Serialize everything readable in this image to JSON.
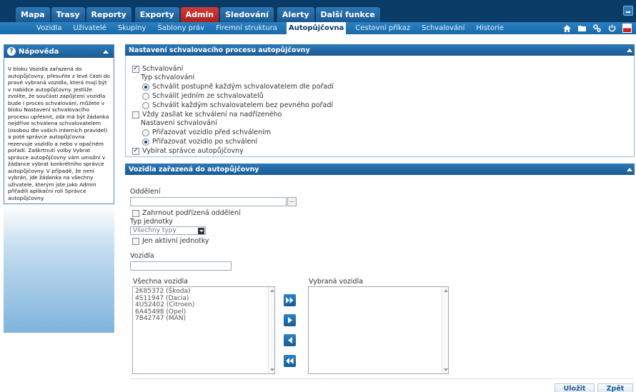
{
  "nav": {
    "tabs": [
      {
        "label": "Mapa"
      },
      {
        "label": "Trasy"
      },
      {
        "label": "Reporty"
      },
      {
        "label": "Exporty"
      },
      {
        "label": "Admin"
      },
      {
        "label": "Sledování"
      },
      {
        "label": "Alerty"
      },
      {
        "label": "Další funkce"
      }
    ],
    "active_tab": "Admin",
    "subnav": [
      {
        "label": "Vozidla"
      },
      {
        "label": "Uživatelé"
      },
      {
        "label": "Skupiny"
      },
      {
        "label": "Šablony práv"
      },
      {
        "label": "Firemní struktura"
      },
      {
        "label": "Autopůjčovna"
      },
      {
        "label": "Cestovní příkaz"
      },
      {
        "label": "Schvalování"
      },
      {
        "label": "Historie"
      }
    ],
    "active_subnav": "Autopůjčovna",
    "tools": {
      "home_icon": "home-icon",
      "folder_icon": "folder-icon",
      "settings_icon": "settings-icon",
      "power_icon": "power-icon",
      "flag_icon": "flag-cz-icon"
    }
  },
  "help": {
    "title": "Nápověda",
    "text": "V bloku Vozidla zařazená do autopůjčovny, přesuňte z levé části do pravé vybraná vozidla, která mají být v nabídce autopůjčovny. Jestliže zvolíte, že součástí zapůjčení vozidla bude i proces schvalování, můžete v bloku Nastavení schvalovacího procesu upřesnit, zda má být žádanka nejdříve schválena schvalovatelem (osobou dle vašich interních pravidel) a poté správce autopůjčovna rezervuje vozidlo a nebo v opačném pořadí. Zaškrtnutí volby Vybrat správce autopůjčovny vám umožní v žádance vybrat konkrétního správce autopůjčovny. V případě, že není vybrán, jde žádanka na všechny uživatele, kterým jste jako Admin přiřadili aplikační roli Správce autopůjčovny."
  },
  "approval": {
    "panel_title": "Nastavení schvalovacího procesu autopůjčovny",
    "schvalovani_label": "Schvalování",
    "schvalovani_checked": true,
    "type_label": "Typ schvalování",
    "type_options": [
      {
        "label": "Schválit postupně každým schvalovatelem dle pořadí",
        "selected": true
      },
      {
        "label": "Schválit jedním ze schvalovatelů",
        "selected": false
      },
      {
        "label": "Schválit každým schvalovatelem bez pevného pořadí",
        "selected": false
      }
    ],
    "superior_label": "Vždy zasílat ke schválení na nadřízeného",
    "superior_checked": false,
    "settings_label": "Nastavení schvalování",
    "settings_options": [
      {
        "label": "Přiřazovat vozidlo před schválením",
        "selected": false
      },
      {
        "label": "Přiřazovat vozidlo po schválení",
        "selected": true
      }
    ],
    "manager_label": "Vybírat správce autopůjčovny",
    "manager_checked": true
  },
  "vehicles": {
    "panel_title": "Vozidla zařazená do autopůjčovny",
    "department_label": "Oddělení",
    "department_value": "",
    "department_button": "...",
    "include_sub_label": "Zahrnout podřízená oddělení",
    "include_sub_checked": false,
    "unit_type_label": "Typ jednotky",
    "unit_type_value": "Všechny typy",
    "active_only_label": "Jen aktivní jednotky",
    "active_only_checked": false,
    "vehicles_filter_label": "Vozidla",
    "vehicles_filter_value": "",
    "all_label": "Všechna vozidla",
    "all_items": [
      "2K85372 (Škoda)",
      "4S11947 (Dacia)",
      "4U52402 (Citroen)",
      "6A45498 (Opel)",
      "7B42747 (MAN)"
    ],
    "selected_label": "Vybraná vozidla",
    "selected_items": []
  },
  "footer": {
    "save_label": "Uložit",
    "back_label": "Zpět"
  }
}
